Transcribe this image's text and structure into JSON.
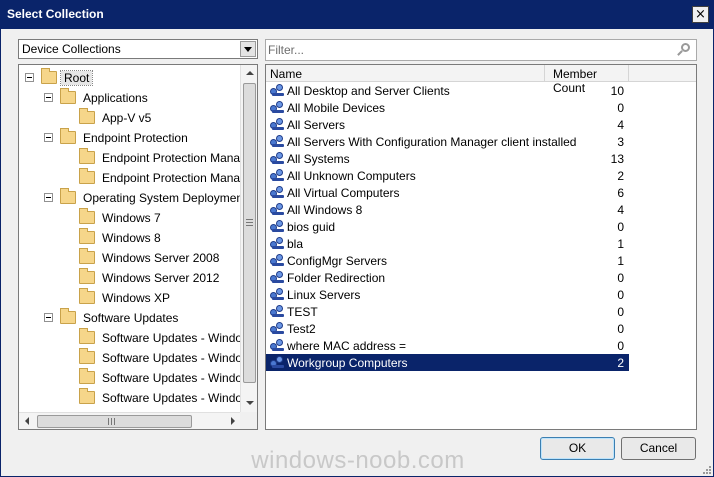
{
  "window": {
    "title": "Select Collection",
    "close_glyph": "×"
  },
  "left": {
    "combo_value": "Device Collections",
    "tree": [
      {
        "label": "Root",
        "level": 0,
        "expander": true,
        "selected": true
      },
      {
        "label": "Applications",
        "level": 1,
        "expander": true
      },
      {
        "label": "App-V v5",
        "level": 2,
        "expander": false
      },
      {
        "label": "Endpoint Protection",
        "level": 1,
        "expander": true
      },
      {
        "label": "Endpoint Protection Manage",
        "level": 2,
        "expander": false
      },
      {
        "label": "Endpoint Protection Manage",
        "level": 2,
        "expander": false
      },
      {
        "label": "Operating System Deployment",
        "level": 1,
        "expander": true
      },
      {
        "label": "Windows 7",
        "level": 2,
        "expander": false
      },
      {
        "label": "Windows 8",
        "level": 2,
        "expander": false
      },
      {
        "label": "Windows Server 2008",
        "level": 2,
        "expander": false
      },
      {
        "label": "Windows Server 2012",
        "level": 2,
        "expander": false
      },
      {
        "label": "Windows XP",
        "level": 2,
        "expander": false
      },
      {
        "label": "Software Updates",
        "level": 1,
        "expander": true
      },
      {
        "label": "Software Updates - Windows",
        "level": 2,
        "expander": false
      },
      {
        "label": "Software Updates - Windows",
        "level": 2,
        "expander": false
      },
      {
        "label": "Software Updates - Windows",
        "level": 2,
        "expander": false
      },
      {
        "label": "Software Updates - Windows",
        "level": 2,
        "expander": false
      }
    ]
  },
  "right": {
    "filter_placeholder": "Filter...",
    "columns": {
      "name": "Name",
      "count": "Member Count"
    },
    "rows": [
      {
        "name": "All Desktop and Server Clients",
        "count": "10"
      },
      {
        "name": "All Mobile Devices",
        "count": "0"
      },
      {
        "name": "All Servers",
        "count": "4"
      },
      {
        "name": "All Servers With Configuration Manager client installed",
        "count": "3"
      },
      {
        "name": "All Systems",
        "count": "13"
      },
      {
        "name": "All Unknown Computers",
        "count": "2"
      },
      {
        "name": "All Virtual Computers",
        "count": "6"
      },
      {
        "name": "All Windows 8",
        "count": "4"
      },
      {
        "name": "bios guid",
        "count": "0"
      },
      {
        "name": "bla",
        "count": "1"
      },
      {
        "name": "ConfigMgr Servers",
        "count": "1"
      },
      {
        "name": "Folder Redirection",
        "count": "0"
      },
      {
        "name": "Linux Servers",
        "count": "0"
      },
      {
        "name": "TEST",
        "count": "0"
      },
      {
        "name": "Test2",
        "count": "0"
      },
      {
        "name": "where MAC address =",
        "count": "0"
      },
      {
        "name": "Workgroup Computers",
        "count": "2",
        "selected": true
      }
    ]
  },
  "buttons": {
    "ok": "OK",
    "cancel": "Cancel"
  },
  "watermark": "windows-noob.com",
  "colors": {
    "titlebar": "#0a246a",
    "selection": "#0a246a"
  }
}
